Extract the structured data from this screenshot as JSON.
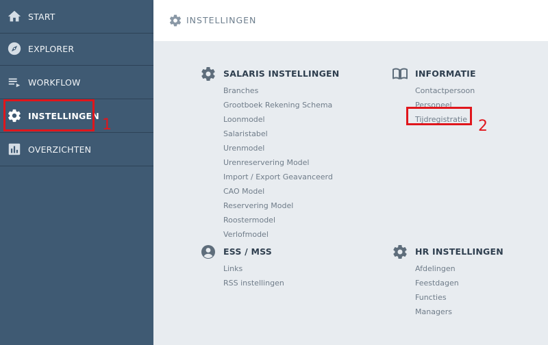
{
  "sidebar": {
    "items": [
      {
        "label": "START",
        "icon": "home-icon"
      },
      {
        "label": "EXPLORER",
        "icon": "compass-icon"
      },
      {
        "label": "WORKFLOW",
        "icon": "playlist-icon"
      },
      {
        "label": "INSTELLINGEN",
        "icon": "gear-icon",
        "active": true
      },
      {
        "label": "OVERZICHTEN",
        "icon": "bar-chart-icon"
      }
    ]
  },
  "header": {
    "title": "INSTELLINGEN",
    "icon": "gear-icon"
  },
  "sections": {
    "salaris": {
      "title": "SALARIS INSTELLINGEN",
      "icon": "gear-icon",
      "links": [
        "Branches",
        "Grootboek Rekening Schema",
        "Loonmodel",
        "Salaristabel",
        "Urenmodel",
        "Urenreservering Model",
        "Import / Export Geavanceerd",
        "CAO Model",
        "Reservering Model",
        "Roostermodel",
        "Verlofmodel"
      ]
    },
    "informatie": {
      "title": "INFORMATIE",
      "icon": "book-icon",
      "links": [
        "Contactpersoon",
        "Personeel",
        "Tijdregistratie"
      ]
    },
    "ess": {
      "title": "ESS / MSS",
      "icon": "account-icon",
      "links": [
        "Links",
        "RSS instellingen"
      ]
    },
    "hr": {
      "title": "HR INSTELLINGEN",
      "icon": "gear-icon",
      "links": [
        "Afdelingen",
        "Feestdagen",
        "Functies",
        "Managers"
      ]
    }
  },
  "annotations": {
    "step1": "1",
    "step2": "2"
  },
  "colors": {
    "sidebar": "#3f5a73",
    "highlight": "#e0161c",
    "content_bg": "#e8ecf0"
  }
}
